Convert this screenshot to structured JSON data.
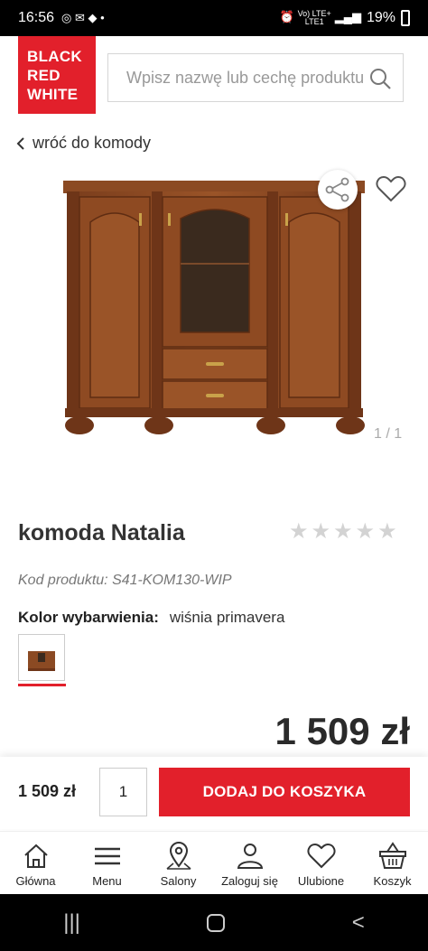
{
  "status_bar": {
    "time": "16:56",
    "battery": "19%"
  },
  "brand": {
    "line1": "BLACK",
    "line2": "RED",
    "line3": "WHITE"
  },
  "search": {
    "placeholder": "Wpisz nazwę lub cechę produktu"
  },
  "back_link": "wróć do komody",
  "gallery": {
    "counter": "1 / 1"
  },
  "product": {
    "name": "komoda Natalia",
    "code_label": "Kod produktu:",
    "code_value": "S41-KOM130-WIP",
    "color_label": "Kolor wybarwienia:",
    "color_value": "wiśnia primavera",
    "price": "1 509 zł",
    "rating_stars": 0
  },
  "cart": {
    "price": "1 509 zł",
    "quantity": "1",
    "add_label": "DODAJ DO KOSZYKA"
  },
  "nav": [
    {
      "label": "Główna",
      "icon": "home-icon"
    },
    {
      "label": "Menu",
      "icon": "menu-icon"
    },
    {
      "label": "Salony",
      "icon": "map-pin-icon"
    },
    {
      "label": "Zaloguj się",
      "icon": "user-icon"
    },
    {
      "label": "Ulubione",
      "icon": "heart-icon"
    },
    {
      "label": "Koszyk",
      "icon": "basket-icon"
    }
  ],
  "colors": {
    "brand_red": "#e2202b",
    "wood": "#8b4a23"
  }
}
